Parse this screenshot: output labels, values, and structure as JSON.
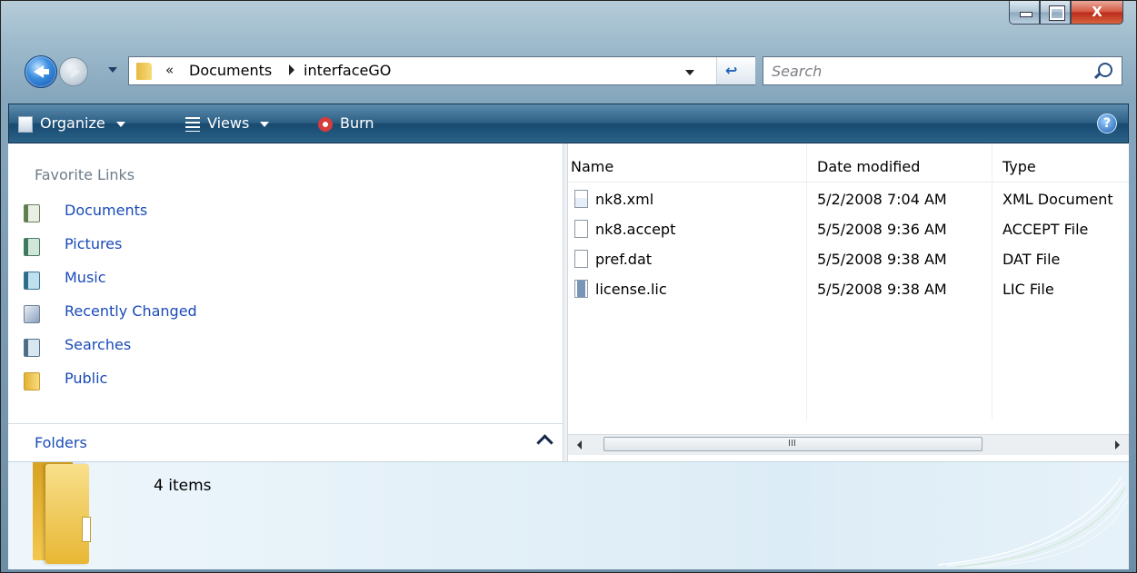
{
  "address_bar": {
    "overflow_chevron": "«",
    "crumbs": [
      "Documents",
      "interfaceGO"
    ]
  },
  "search": {
    "placeholder": "Search"
  },
  "toolbar": {
    "organize_label": "Organize",
    "views_label": "Views",
    "burn_label": "Burn",
    "help_label": "?"
  },
  "nav_pane": {
    "favorites_title": "Favorite Links",
    "favorites": [
      {
        "label": "Documents",
        "icon": "documents-icon"
      },
      {
        "label": "Pictures",
        "icon": "pictures-icon"
      },
      {
        "label": "Music",
        "icon": "music-icon"
      },
      {
        "label": "Recently Changed",
        "icon": "recently-changed-icon"
      },
      {
        "label": "Searches",
        "icon": "searches-icon"
      },
      {
        "label": "Public",
        "icon": "public-folder-icon"
      }
    ],
    "folders_label": "Folders"
  },
  "file_list": {
    "columns": [
      "Name",
      "Date modified",
      "Type"
    ],
    "rows": [
      {
        "name": "nk8.xml",
        "date": "5/2/2008 7:04 AM",
        "type": "XML Document",
        "icon": "xml-file-icon"
      },
      {
        "name": "nk8.accept",
        "date": "5/5/2008 9:36 AM",
        "type": "ACCEPT File",
        "icon": "generic-file-icon"
      },
      {
        "name": "pref.dat",
        "date": "5/5/2008 9:38 AM",
        "type": "DAT File",
        "icon": "generic-file-icon"
      },
      {
        "name": "license.lic",
        "date": "5/5/2008 9:38 AM",
        "type": "LIC File",
        "icon": "lic-file-icon"
      }
    ]
  },
  "details_pane": {
    "item_count": "4 items"
  },
  "scrollbar": {
    "grip": "III"
  },
  "caption": {
    "close_glyph": "X"
  }
}
